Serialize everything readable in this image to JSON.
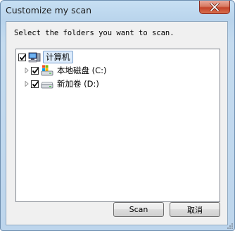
{
  "window": {
    "title": "Customize my scan",
    "close_icon": "close-icon"
  },
  "dialog": {
    "instruction": "Select the folders you want to scan.",
    "tree": {
      "root": {
        "label": "计算机",
        "checked": true,
        "icon": "computer-icon",
        "selected": true
      },
      "children": [
        {
          "label": "本地磁盘 (C:)",
          "checked": true,
          "icon": "system-drive-icon",
          "expander": "collapsed"
        },
        {
          "label": "新加卷 (D:)",
          "checked": true,
          "icon": "drive-icon",
          "expander": "collapsed"
        }
      ]
    },
    "buttons": {
      "scan": "Scan",
      "cancel": "取消"
    }
  },
  "colors": {
    "titlebar": "#c7dff3",
    "close_button": "#c4432a",
    "selection": "#ddecfc"
  }
}
